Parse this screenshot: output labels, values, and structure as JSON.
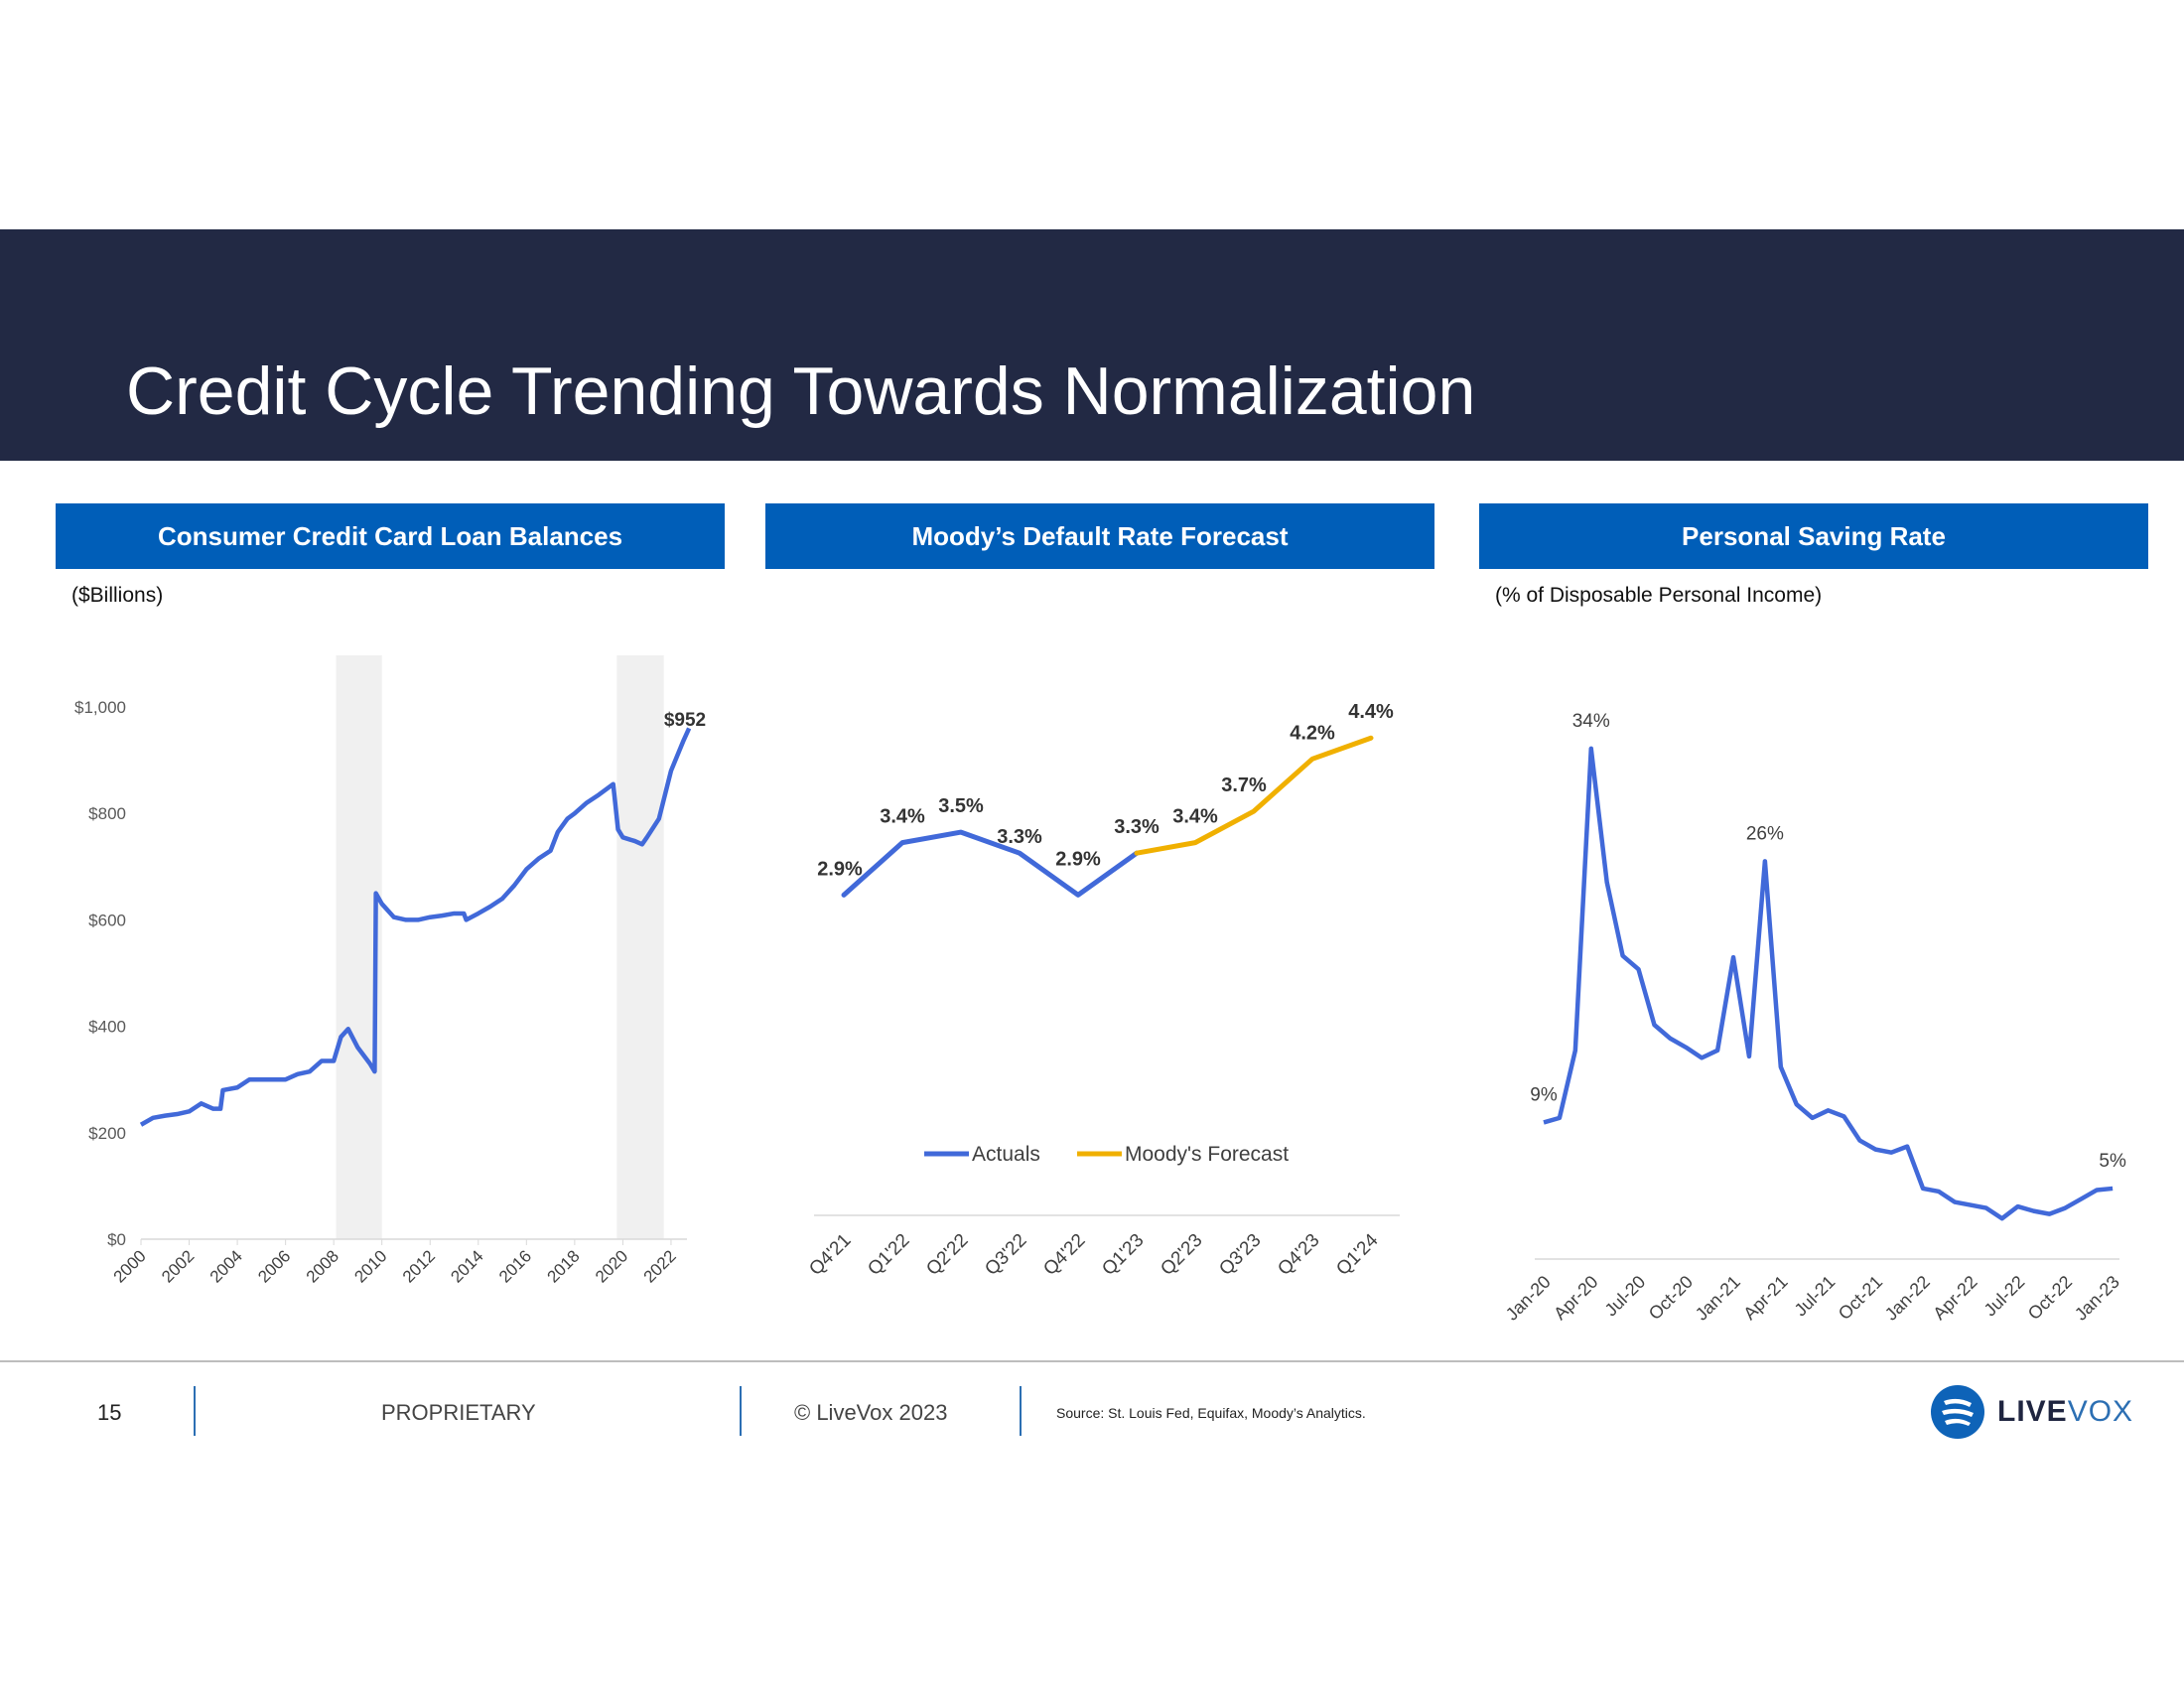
{
  "header": {
    "title": "Credit Cycle Trending Towards Normalization"
  },
  "colors": {
    "header_bg": "#222944",
    "panel_header": "#005EB8",
    "line_blue": "#4169D9",
    "forecast_gold": "#F0B000",
    "recession_shade": "#F0F0F0"
  },
  "panels": [
    {
      "title": "Consumer Credit Card Loan Balances",
      "subtitle": "($Billions)"
    },
    {
      "title": "Moody’s Default Rate Forecast",
      "subtitle": ""
    },
    {
      "title": "Personal Saving Rate",
      "subtitle": "(% of Disposable Personal Income)"
    }
  ],
  "chart_data": [
    {
      "type": "line",
      "ylim": [
        0,
        1000
      ],
      "xlim": [
        2000,
        2022.75
      ],
      "y_ticks": [
        "$0",
        "$200",
        "$400",
        "$600",
        "$800",
        "$1,000"
      ],
      "y_tick_values": [
        0,
        200,
        400,
        600,
        800,
        1000
      ],
      "x_ticks": [
        "2000",
        "2002",
        "2004",
        "2006",
        "2008",
        "2010",
        "2012",
        "2014",
        "2016",
        "2018",
        "2020",
        "2022"
      ],
      "recession_bands": [
        [
          2008.1,
          2010.0
        ],
        [
          2019.75,
          2021.7
        ]
      ],
      "end_label": "$952",
      "x": [
        2000,
        2000.5,
        2001,
        2001.5,
        2002,
        2002.5,
        2003,
        2003.3,
        2003.4,
        2004,
        2004.5,
        2005,
        2005.5,
        2006,
        2006.5,
        2007,
        2007.5,
        2008,
        2008.3,
        2008.6,
        2009,
        2009.5,
        2009.7,
        2009.75,
        2010,
        2010.5,
        2011,
        2011.5,
        2012,
        2012.5,
        2013,
        2013.4,
        2013.5,
        2014,
        2014.5,
        2015,
        2015.5,
        2016,
        2016.5,
        2017,
        2017.3,
        2017.7,
        2018,
        2018.5,
        2019,
        2019.6,
        2019.8,
        2020,
        2020.5,
        2020.8,
        2021,
        2021.5,
        2022,
        2022.5,
        2022.75
      ],
      "y": [
        215,
        228,
        232,
        235,
        240,
        255,
        245,
        245,
        280,
        285,
        300,
        300,
        300,
        300,
        310,
        315,
        335,
        335,
        380,
        395,
        360,
        330,
        315,
        650,
        630,
        605,
        600,
        600,
        605,
        608,
        612,
        612,
        600,
        612,
        625,
        640,
        665,
        695,
        715,
        730,
        765,
        790,
        800,
        820,
        835,
        855,
        770,
        755,
        748,
        742,
        755,
        790,
        880,
        935,
        960
      ]
    },
    {
      "type": "line",
      "categories": [
        "Q4'21",
        "Q1'22",
        "Q2'22",
        "Q3'22",
        "Q4'22",
        "Q1'23",
        "Q2'23",
        "Q3'23",
        "Q4'23",
        "Q1'24"
      ],
      "ylim": [
        0,
        5
      ],
      "series": [
        {
          "name": "Actuals",
          "values": [
            2.9,
            3.4,
            3.5,
            3.3,
            2.9,
            3.3,
            null,
            null,
            null,
            null
          ],
          "color": "#4169D9"
        },
        {
          "name": "Moody's Forecast",
          "values": [
            null,
            null,
            null,
            null,
            null,
            3.3,
            3.4,
            3.7,
            4.2,
            4.4
          ],
          "color": "#F0B000"
        }
      ],
      "data_labels": [
        "2.9%",
        "3.4%",
        "3.5%",
        "3.3%",
        "2.9%",
        "3.3%",
        "3.4%",
        "3.7%",
        "4.2%",
        "4.4%"
      ],
      "legend": "bottom"
    },
    {
      "type": "line",
      "ylim": [
        0,
        34
      ],
      "x_ticks": [
        "Jan-20",
        "Apr-20",
        "Jul-20",
        "Oct-20",
        "Jan-21",
        "Apr-21",
        "Jul-21",
        "Oct-21",
        "Jan-22",
        "Apr-22",
        "Jul-22",
        "Oct-22",
        "Jan-23"
      ],
      "values": [
        9.1,
        9.4,
        13.9,
        34.0,
        25.1,
        20.2,
        19.3,
        15.6,
        14.7,
        14.1,
        13.4,
        13.9,
        20.1,
        13.5,
        26.5,
        12.8,
        10.3,
        9.4,
        9.9,
        9.5,
        7.9,
        7.3,
        7.1,
        7.5,
        4.7,
        4.5,
        3.8,
        3.6,
        3.4,
        2.7,
        3.5,
        3.2,
        3.0,
        3.4,
        4.0,
        4.6,
        4.7
      ],
      "annotations": [
        {
          "index": 0,
          "label": "9%"
        },
        {
          "index": 3,
          "label": "34%"
        },
        {
          "index": 14,
          "label": "26%"
        },
        {
          "index": 36,
          "label": "5%"
        }
      ]
    }
  ],
  "footer": {
    "page": "15",
    "proprietary": "PROPRIETARY",
    "copyright": "© LiveVox 2023",
    "source": "Source: St. Louis Fed, Equifax, Moody’s Analytics.",
    "logo_text_a": "LIVE",
    "logo_text_b": "VOX"
  }
}
